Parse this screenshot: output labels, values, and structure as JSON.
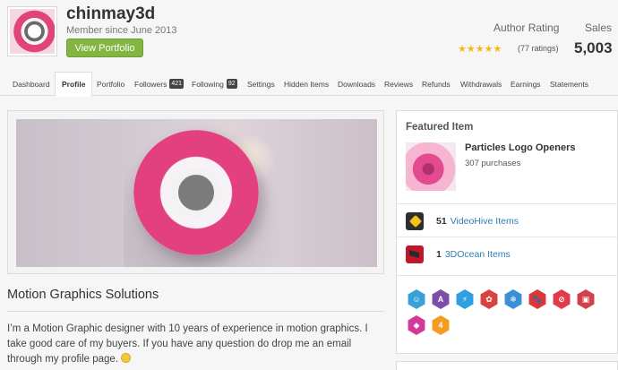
{
  "profile": {
    "username": "chinmay3d",
    "member_since": "Member since June 2013",
    "view_portfolio_label": "View Portfolio",
    "author_rating_label": "Author Rating",
    "stars": "★★★★★",
    "ratings_count": "(77 ratings)",
    "sales_label": "Sales",
    "sales_value": "5,003"
  },
  "tabs": [
    {
      "label": "Dashboard"
    },
    {
      "label": "Profile"
    },
    {
      "label": "Portfolio"
    },
    {
      "label": "Followers",
      "count": "421"
    },
    {
      "label": "Following",
      "count": "92"
    },
    {
      "label": "Settings"
    },
    {
      "label": "Hidden Items"
    },
    {
      "label": "Downloads"
    },
    {
      "label": "Reviews"
    },
    {
      "label": "Refunds"
    },
    {
      "label": "Withdrawals"
    },
    {
      "label": "Earnings"
    },
    {
      "label": "Statements"
    }
  ],
  "main": {
    "section_title": "Motion Graphics Solutions",
    "bio": "I’m a Motion Graphic designer with 10 years of experience in motion graphics. I take good care of my buyers. If you have any question do drop me an email through my profile page."
  },
  "sidebar": {
    "featured_label": "Featured Item",
    "featured_title": "Particles Logo Openers",
    "featured_purchases": "307 purchases",
    "sites": [
      {
        "count": "51",
        "link": "VideoHive Items",
        "icon": "videohive-icon"
      },
      {
        "count": "1",
        "link": "3DOcean Items",
        "icon": "3docean-icon"
      }
    ],
    "badges": [
      {
        "name": "author-level-badge",
        "color": "#3aa0d8",
        "glyph": "☺"
      },
      {
        "name": "author-badge",
        "color": "#7b4fa8",
        "glyph": "A"
      },
      {
        "name": "elite-badge",
        "color": "#2e9fe0",
        "glyph": "⚡"
      },
      {
        "name": "bundle-badge",
        "color": "#d8423f",
        "glyph": "✿"
      },
      {
        "name": "winter-badge",
        "color": "#3a8fd6",
        "glyph": "❄"
      },
      {
        "name": "paw-badge",
        "color": "#d83a36",
        "glyph": "🐾"
      },
      {
        "name": "affiliate-badge",
        "color": "#e03b4b",
        "glyph": "⊘"
      },
      {
        "name": "exclusive-badge",
        "color": "#d33f4a",
        "glyph": "▣"
      },
      {
        "name": "diamond-badge",
        "color": "#d2399a",
        "glyph": "◆"
      },
      {
        "name": "years-badge",
        "color": "#f39c1f",
        "glyph": "4"
      }
    ]
  },
  "colors": {
    "accent_green": "#82b541",
    "link_blue": "#2e7eb6",
    "star_yellow": "#f5b819"
  }
}
